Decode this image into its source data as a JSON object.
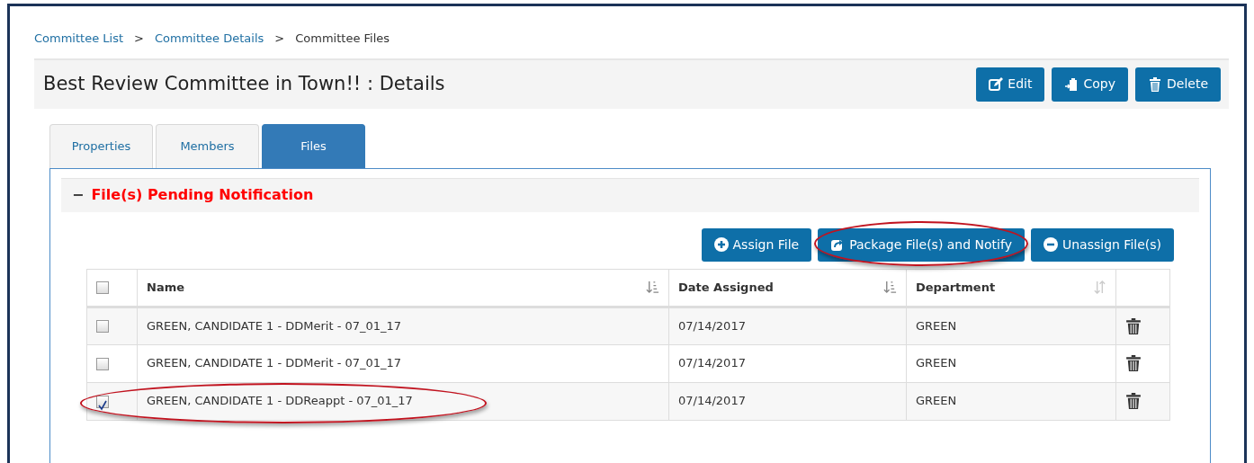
{
  "breadcrumb": [
    {
      "label": "Committee List",
      "link": true
    },
    {
      "label": "Committee Details",
      "link": true
    },
    {
      "label": "Committee Files",
      "link": false
    }
  ],
  "breadcrumb_separator": ">",
  "header": {
    "title": "Best Review Committee in Town!! : Details",
    "buttons": [
      {
        "kind": "edit",
        "label": "Edit"
      },
      {
        "kind": "copy",
        "label": "Copy"
      },
      {
        "kind": "delete",
        "label": "Delete"
      }
    ]
  },
  "tabs": [
    {
      "label": "Properties",
      "selected": false
    },
    {
      "label": "Members",
      "selected": false
    },
    {
      "label": "Files",
      "selected": true
    }
  ],
  "section": {
    "toggle": "−",
    "title": "File(s) Pending Notification"
  },
  "actions": [
    {
      "kind": "assign",
      "label": "Assign File",
      "highlighted": false
    },
    {
      "kind": "package",
      "label": "Package File(s) and Notify",
      "highlighted": true
    },
    {
      "kind": "unassign",
      "label": "Unassign File(s)",
      "highlighted": false
    }
  ],
  "table": {
    "select_all": false,
    "columns": [
      {
        "label": "Name",
        "sorted": true
      },
      {
        "label": "Date Assigned",
        "sorted": true
      },
      {
        "label": "Department",
        "sorted": false
      }
    ],
    "rows": [
      {
        "checked": false,
        "highlighted": false,
        "name": "GREEN, CANDIDATE 1 - DDMerit - 07_01_17",
        "date": "07/14/2017",
        "department": "GREEN"
      },
      {
        "checked": false,
        "highlighted": false,
        "name": "GREEN, CANDIDATE 1 - DDMerit - 07_01_17",
        "date": "07/14/2017",
        "department": "GREEN"
      },
      {
        "checked": true,
        "highlighted": true,
        "name": "GREEN, CANDIDATE 1 - DDReappt - 07_01_17",
        "date": "07/14/2017",
        "department": "GREEN"
      }
    ]
  }
}
